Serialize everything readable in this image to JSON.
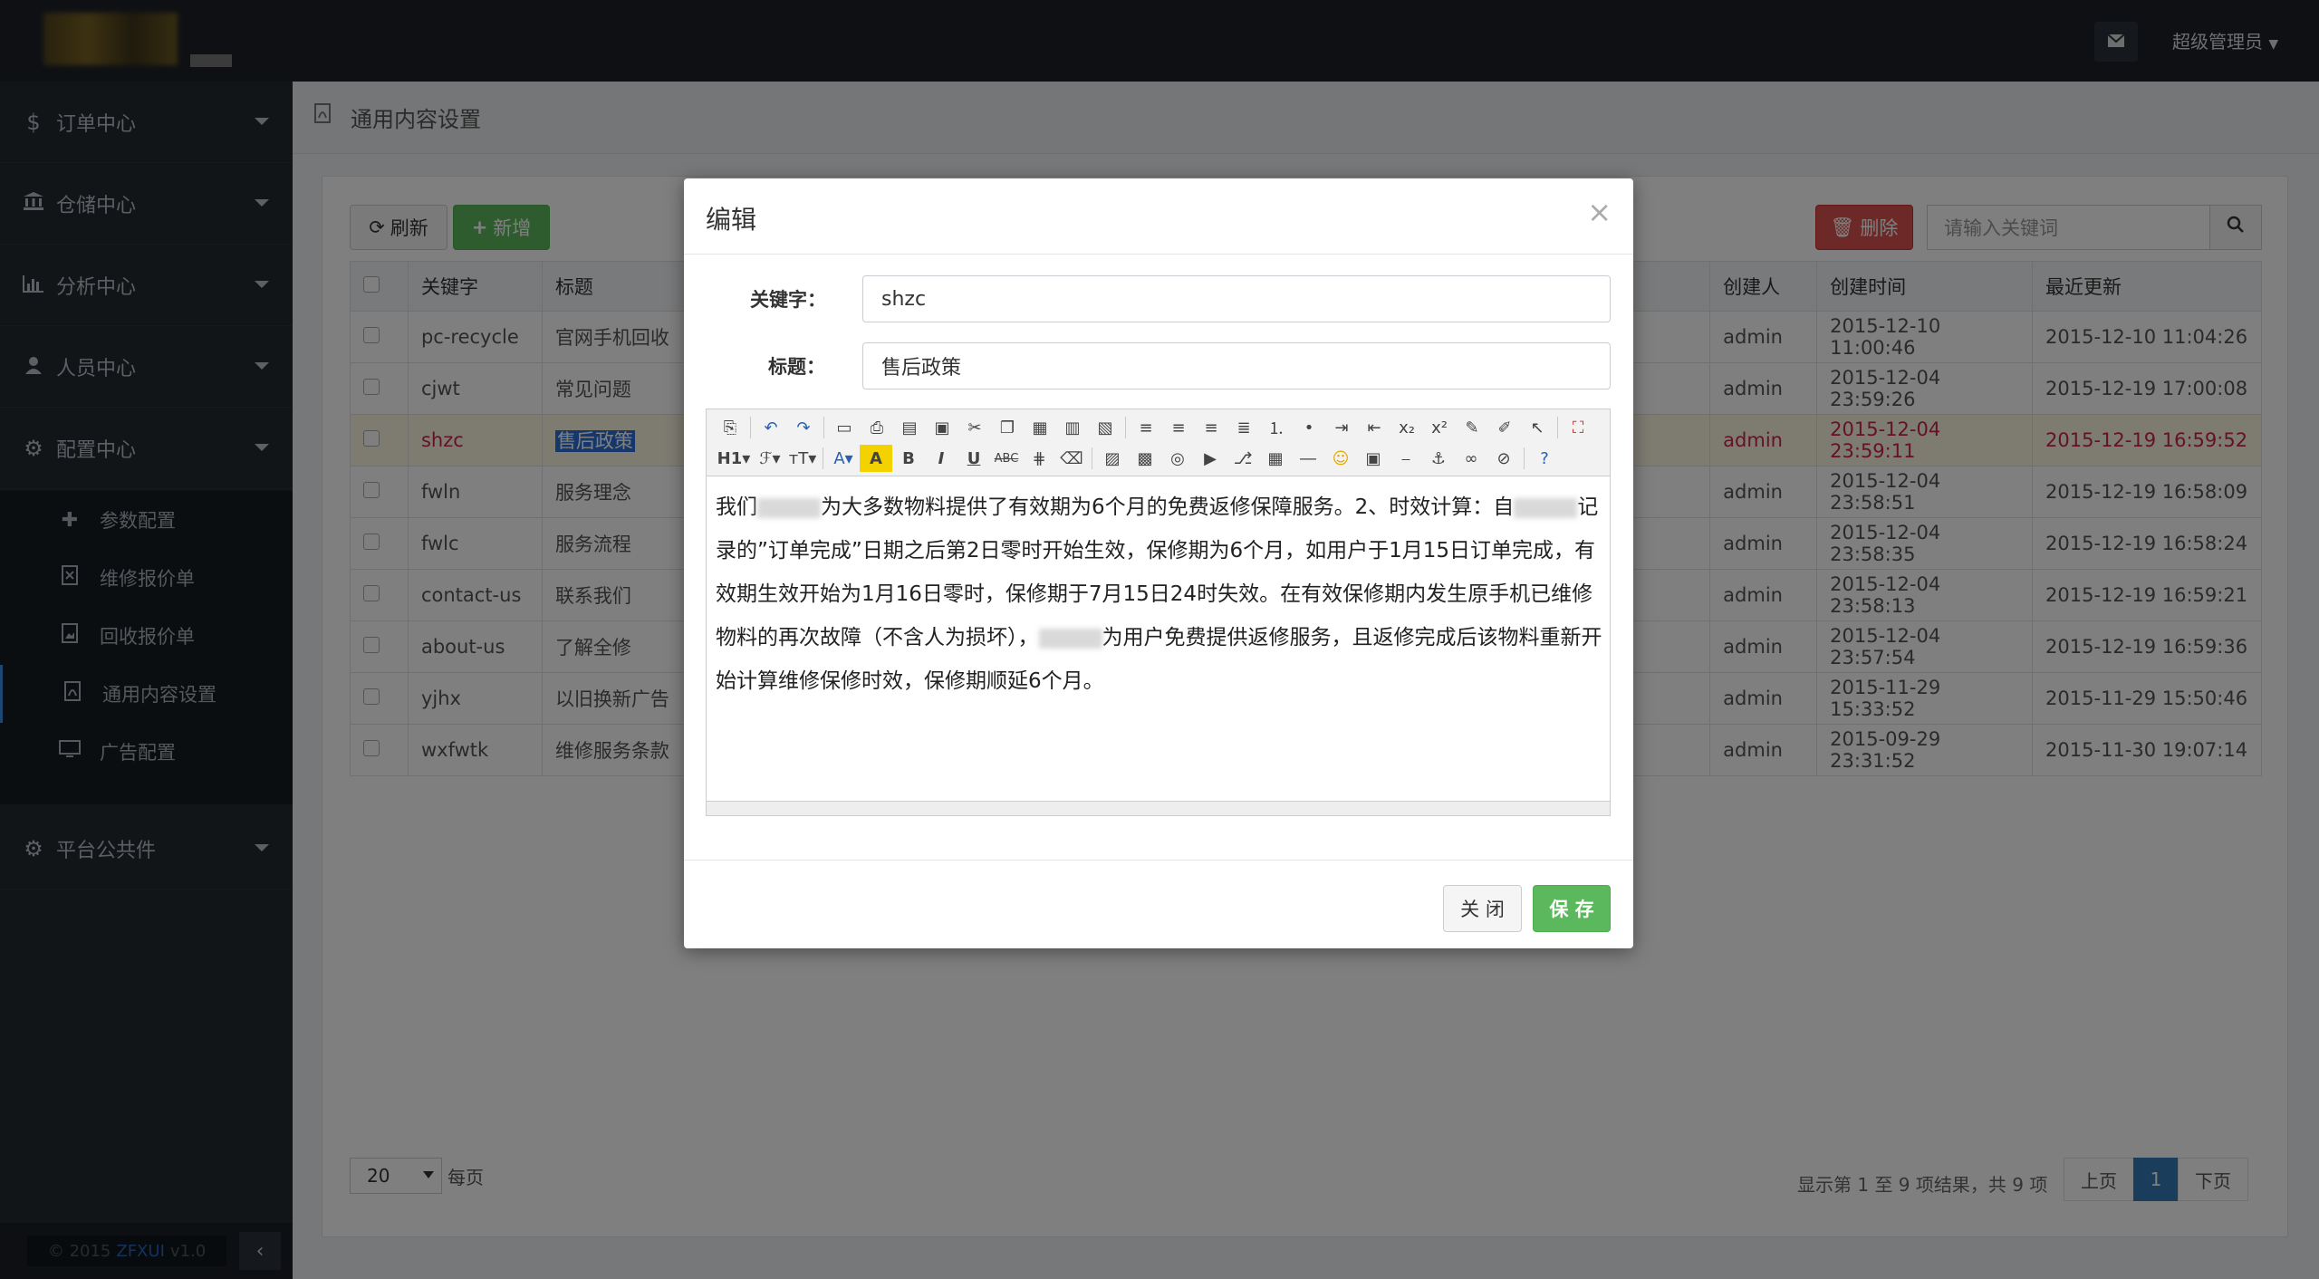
{
  "topbar": {
    "user_menu": "超级管理员",
    "mail_icon": "envelope-icon"
  },
  "sidebar": {
    "items": [
      {
        "label": "订单中心",
        "icon": "dollar-icon"
      },
      {
        "label": "仓储中心",
        "icon": "bank-icon"
      },
      {
        "label": "分析中心",
        "icon": "bar-chart-icon"
      },
      {
        "label": "人员中心",
        "icon": "user-icon"
      },
      {
        "label": "配置中心",
        "icon": "gear-icon"
      },
      {
        "label": "平台公共件",
        "icon": "gears-icon"
      }
    ],
    "sub_items": [
      {
        "label": "参数配置",
        "icon": "puzzle-icon"
      },
      {
        "label": "维修报价单",
        "icon": "excel-file-icon"
      },
      {
        "label": "回收报价单",
        "icon": "image-file-icon"
      },
      {
        "label": "通用内容设置",
        "icon": "pdf-file-icon"
      },
      {
        "label": "广告配置",
        "icon": "monitor-icon"
      }
    ],
    "copyright_prefix": "© 2015",
    "copyright_brand": "ZFXUI",
    "copyright_version": "v1.0"
  },
  "page": {
    "title": "通用内容设置"
  },
  "toolbar": {
    "refresh_label": "刷新",
    "add_label": "新增",
    "delete_label": "删除",
    "search_placeholder": "请输入关键词"
  },
  "table": {
    "columns": [
      "关键字",
      "标题",
      "创建人",
      "创建时间",
      "最近更新"
    ],
    "rows": [
      {
        "key": "pc-recycle",
        "title": "官网手机回收",
        "creator": "admin",
        "created": "2015-12-10 11:00:46",
        "updated": "2015-12-10 11:04:26"
      },
      {
        "key": "cjwt",
        "title": "常见问题",
        "creator": "admin",
        "created": "2015-12-04 23:59:26",
        "updated": "2015-12-19 17:00:08"
      },
      {
        "key": "shzc",
        "title": "售后政策",
        "creator": "admin",
        "created": "2015-12-04 23:59:11",
        "updated": "2015-12-19 16:59:52"
      },
      {
        "key": "fwln",
        "title": "服务理念",
        "creator": "admin",
        "created": "2015-12-04 23:58:51",
        "updated": "2015-12-19 16:58:09"
      },
      {
        "key": "fwlc",
        "title": "服务流程",
        "creator": "admin",
        "created": "2015-12-04 23:58:35",
        "updated": "2015-12-19 16:58:24"
      },
      {
        "key": "contact-us",
        "title": "联系我们",
        "creator": "admin",
        "created": "2015-12-04 23:58:13",
        "updated": "2015-12-19 16:59:21"
      },
      {
        "key": "about-us",
        "title": "了解全修",
        "creator": "admin",
        "created": "2015-12-04 23:57:54",
        "updated": "2015-12-19 16:59:36"
      },
      {
        "key": "yjhx",
        "title": "以旧换新广告",
        "creator": "admin",
        "created": "2015-11-29 15:33:52",
        "updated": "2015-11-29 15:50:46"
      },
      {
        "key": "wxfwtk",
        "title": "维修服务条款",
        "creator": "admin",
        "created": "2015-09-29 23:31:52",
        "updated": "2015-11-30 19:07:14"
      }
    ]
  },
  "pager": {
    "page_size": "20",
    "per_page_label": "每页",
    "info": "显示第 1 至 9 项结果，共 9 项",
    "prev": "上页",
    "current": "1",
    "next": "下页"
  },
  "modal": {
    "title": "编辑",
    "close_glyph": "×",
    "keyword_label": "关键字：",
    "keyword_value": "shzc",
    "title_label": "标题：",
    "title_value": "售后政策",
    "heading_btn": "H1",
    "content": {
      "p1": "我们",
      "p2": "为大多数物料提供了有效期为6个月的免费返修保障服务。2、时效计算：自",
      "p3": "记录的”订单完成”日期之后第2日零时开始生效，保修期为6个月，如用户于1月15日订单完成，有效期生效开始为1月16日零时，保修期于7月15日24时失效。在有效保修期内发生原手机已维修物料的再次故障（不含人为损坏），",
      "p4": "为用户免费提供返修服务，且返修完成后该物料重新开始计算维修保修时效，保修期顺延6个月。"
    },
    "close_button": "关 闭",
    "save_button": "保 存"
  }
}
